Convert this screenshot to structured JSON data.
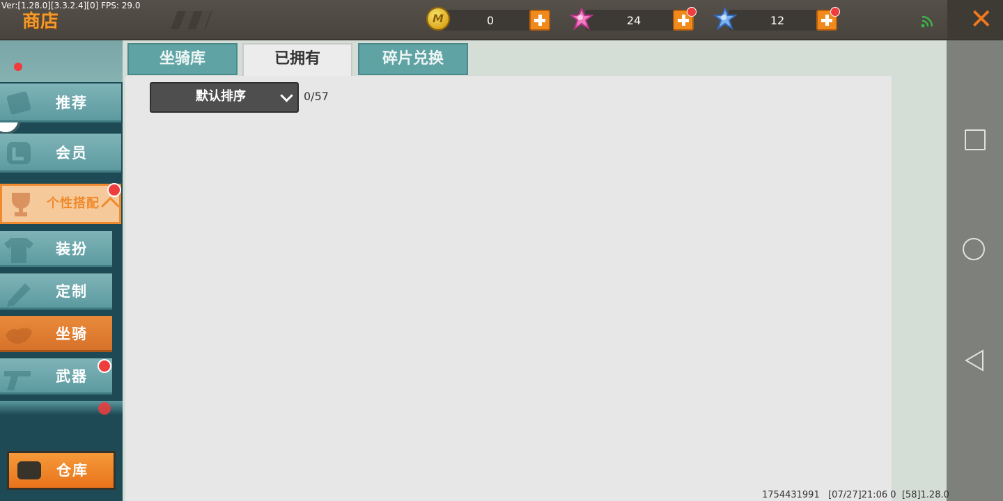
{
  "version_info": "Ver:[1.28.0][3.3.2.4][0] FPS: 29.0",
  "header": {
    "title": "商店",
    "currencies": [
      {
        "icon": "mini-coin-icon",
        "value": "0",
        "has_notification": false
      },
      {
        "icon": "pink-star-gem-icon",
        "value": "24",
        "has_notification": true
      },
      {
        "icon": "blue-star-gem-icon",
        "value": "12",
        "has_notification": true
      }
    ],
    "coin_symbol": "M"
  },
  "sidebar": {
    "items": [
      {
        "label": "推荐",
        "icon": "recommend-icon",
        "state": "normal"
      },
      {
        "label": "会员",
        "icon": "member-icon",
        "state": "normal"
      },
      {
        "label": "个性搭配",
        "icon": "trophy-icon",
        "state": "expanded",
        "has_notification": true
      },
      {
        "label": "装扮",
        "icon": "shirt-icon",
        "state": "sub"
      },
      {
        "label": "定制",
        "icon": "pencil-icon",
        "state": "sub"
      },
      {
        "label": "坐骑",
        "icon": "saddle-icon",
        "state": "selected"
      },
      {
        "label": "武器",
        "icon": "revolver-icon",
        "state": "sub",
        "has_notification": true
      }
    ],
    "warehouse_label": "仓库"
  },
  "tabs": [
    {
      "label": "坐骑库",
      "active": false
    },
    {
      "label": "已拥有",
      "active": true
    },
    {
      "label": "碎片兑换",
      "active": false
    }
  ],
  "content": {
    "sort_label": "默认排序",
    "count": "0/57"
  },
  "footer": {
    "info": "1754431991   [07/27]21:06 0  [58]1.28.0"
  },
  "colors": {
    "accent_orange": "#f08a2c",
    "teal": "#60a3a4",
    "notification_red": "#ef3c3c"
  }
}
